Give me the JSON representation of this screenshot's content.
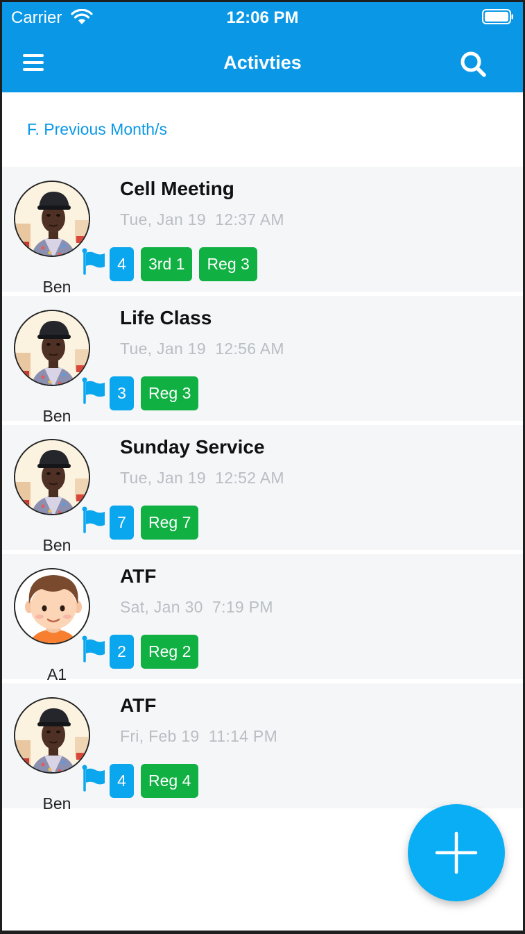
{
  "status_bar": {
    "carrier": "Carrier",
    "time": "12:06 PM"
  },
  "nav": {
    "title": "Activties"
  },
  "filter": {
    "label": "F. Previous Month/s"
  },
  "activities": [
    {
      "title": "Cell Meeting",
      "date": "Tue, Jan 19  12:37 AM",
      "user": "Ben",
      "avatar": "photo",
      "count": "4",
      "tags": [
        "3rd 1",
        "Reg 3"
      ]
    },
    {
      "title": "Life Class",
      "date": "Tue, Jan 19  12:56 AM",
      "user": "Ben",
      "avatar": "photo",
      "count": "3",
      "tags": [
        "Reg 3"
      ]
    },
    {
      "title": "Sunday Service",
      "date": "Tue, Jan 19  12:52 AM",
      "user": "Ben",
      "avatar": "photo",
      "count": "7",
      "tags": [
        "Reg 7"
      ]
    },
    {
      "title": "ATF",
      "date": "Sat, Jan 30  7:19 PM",
      "user": "A1",
      "avatar": "cartoon",
      "count": "2",
      "tags": [
        "Reg 2"
      ]
    },
    {
      "title": "ATF",
      "date": "Fri, Feb 19  11:14 PM",
      "user": "Ben",
      "avatar": "photo",
      "count": "4",
      "tags": [
        "Reg 4"
      ]
    }
  ],
  "colors": {
    "primary": "#0a98e6",
    "count_badge": "#0aa6ee",
    "tag_badge": "#10b043",
    "fab": "#0aaef4"
  },
  "icons": {
    "menu": "hamburger-icon",
    "search": "search-icon",
    "flag": "flag-icon",
    "add": "plus-icon"
  }
}
